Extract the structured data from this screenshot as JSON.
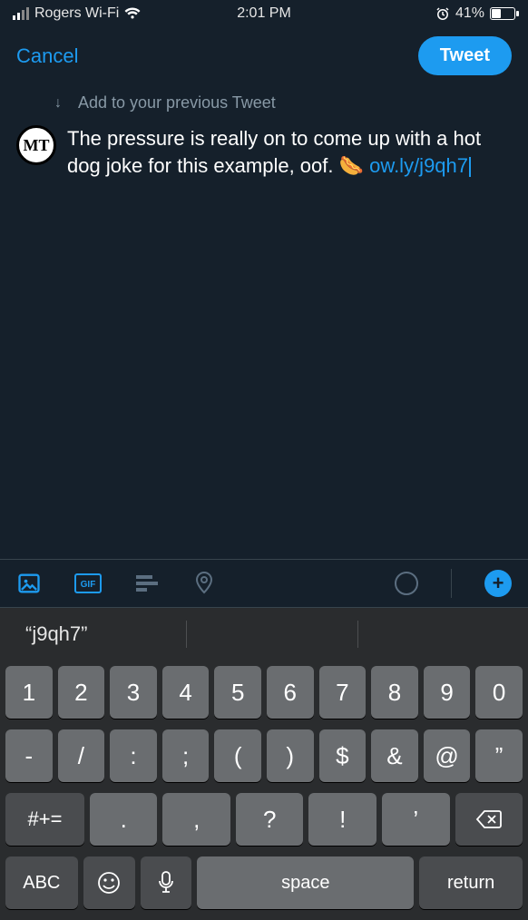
{
  "status": {
    "carrier": "Rogers Wi-Fi",
    "time": "2:01 PM",
    "battery_pct": "41%"
  },
  "nav": {
    "cancel": "Cancel",
    "tweet": "Tweet"
  },
  "compose": {
    "add_previous": "Add to your previous Tweet",
    "avatar_initials": "MT",
    "text_plain": "The pressure is really on to come up with a hot dog joke for this example, oof. ",
    "emoji": "🌭",
    "link": "ow.ly/j9qh7"
  },
  "toolbar": {
    "photo": "photo",
    "gif": "GIF",
    "poll": "poll",
    "location": "location"
  },
  "keyboard": {
    "suggestion": "“j9qh7”",
    "rows": {
      "r1": [
        "1",
        "2",
        "3",
        "4",
        "5",
        "6",
        "7",
        "8",
        "9",
        "0"
      ],
      "r2": [
        "-",
        "/",
        ":",
        ";",
        "(",
        ")",
        "$",
        "&",
        "@",
        "”"
      ],
      "r3_shift": "#+=",
      "r3_keys": [
        ".",
        ",",
        "?",
        "!",
        "’"
      ],
      "abc": "ABC",
      "space": "space",
      "return": "return"
    }
  }
}
